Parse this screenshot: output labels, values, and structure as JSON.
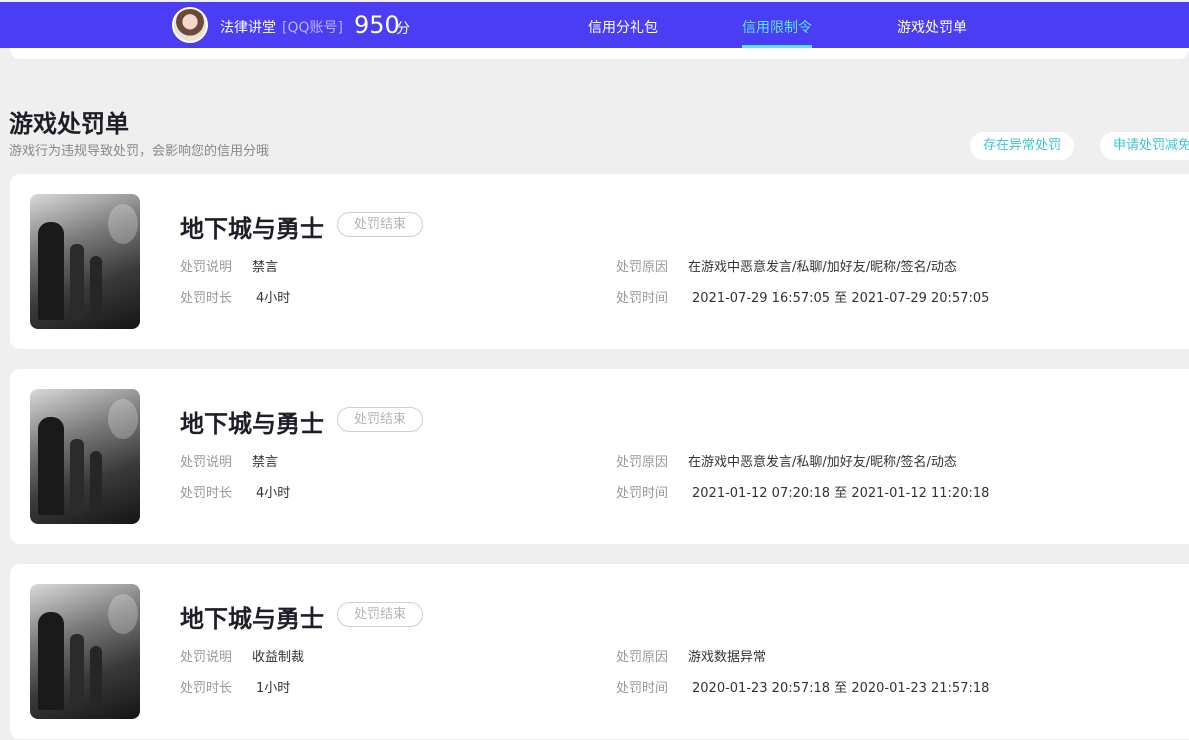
{
  "topbar": {
    "username": "法律讲堂",
    "account": "[QQ账号]",
    "score": "950",
    "score_unit": "分",
    "nav": [
      {
        "label": "信用分礼包",
        "active": false
      },
      {
        "label": "信用限制令",
        "active": true
      },
      {
        "label": "游戏处罚单",
        "active": false
      }
    ],
    "accent": "#4a3df4",
    "active_color": "#5ee3ff"
  },
  "section": {
    "title": "游戏处罚单",
    "subtitle": "游戏行为违规导致处罚，会影响您的信用分哦",
    "buttons": [
      "存在异常处罚",
      "申请处罚减免"
    ]
  },
  "labels": {
    "desc": "处罚说明",
    "duration": "处罚时长",
    "reason": "处罚原因",
    "time": "处罚时间"
  },
  "records": [
    {
      "game": "地下城与勇士",
      "status": "处罚结束",
      "desc": "禁言",
      "duration": "4小时",
      "reason": "在游戏中恶意发言/私聊/加好友/昵称/签名/动态",
      "time": "2021-07-29 16:57:05 至 2021-07-29 20:57:05"
    },
    {
      "game": "地下城与勇士",
      "status": "处罚结束",
      "desc": "禁言",
      "duration": "4小时",
      "reason": "在游戏中恶意发言/私聊/加好友/昵称/签名/动态",
      "time": "2021-01-12 07:20:18 至 2021-01-12 11:20:18"
    },
    {
      "game": "地下城与勇士",
      "status": "处罚结束",
      "desc": "收益制裁",
      "duration": "1小时",
      "reason": "游戏数据异常",
      "time": "2020-01-23 20:57:18 至 2020-01-23 21:57:18"
    }
  ]
}
